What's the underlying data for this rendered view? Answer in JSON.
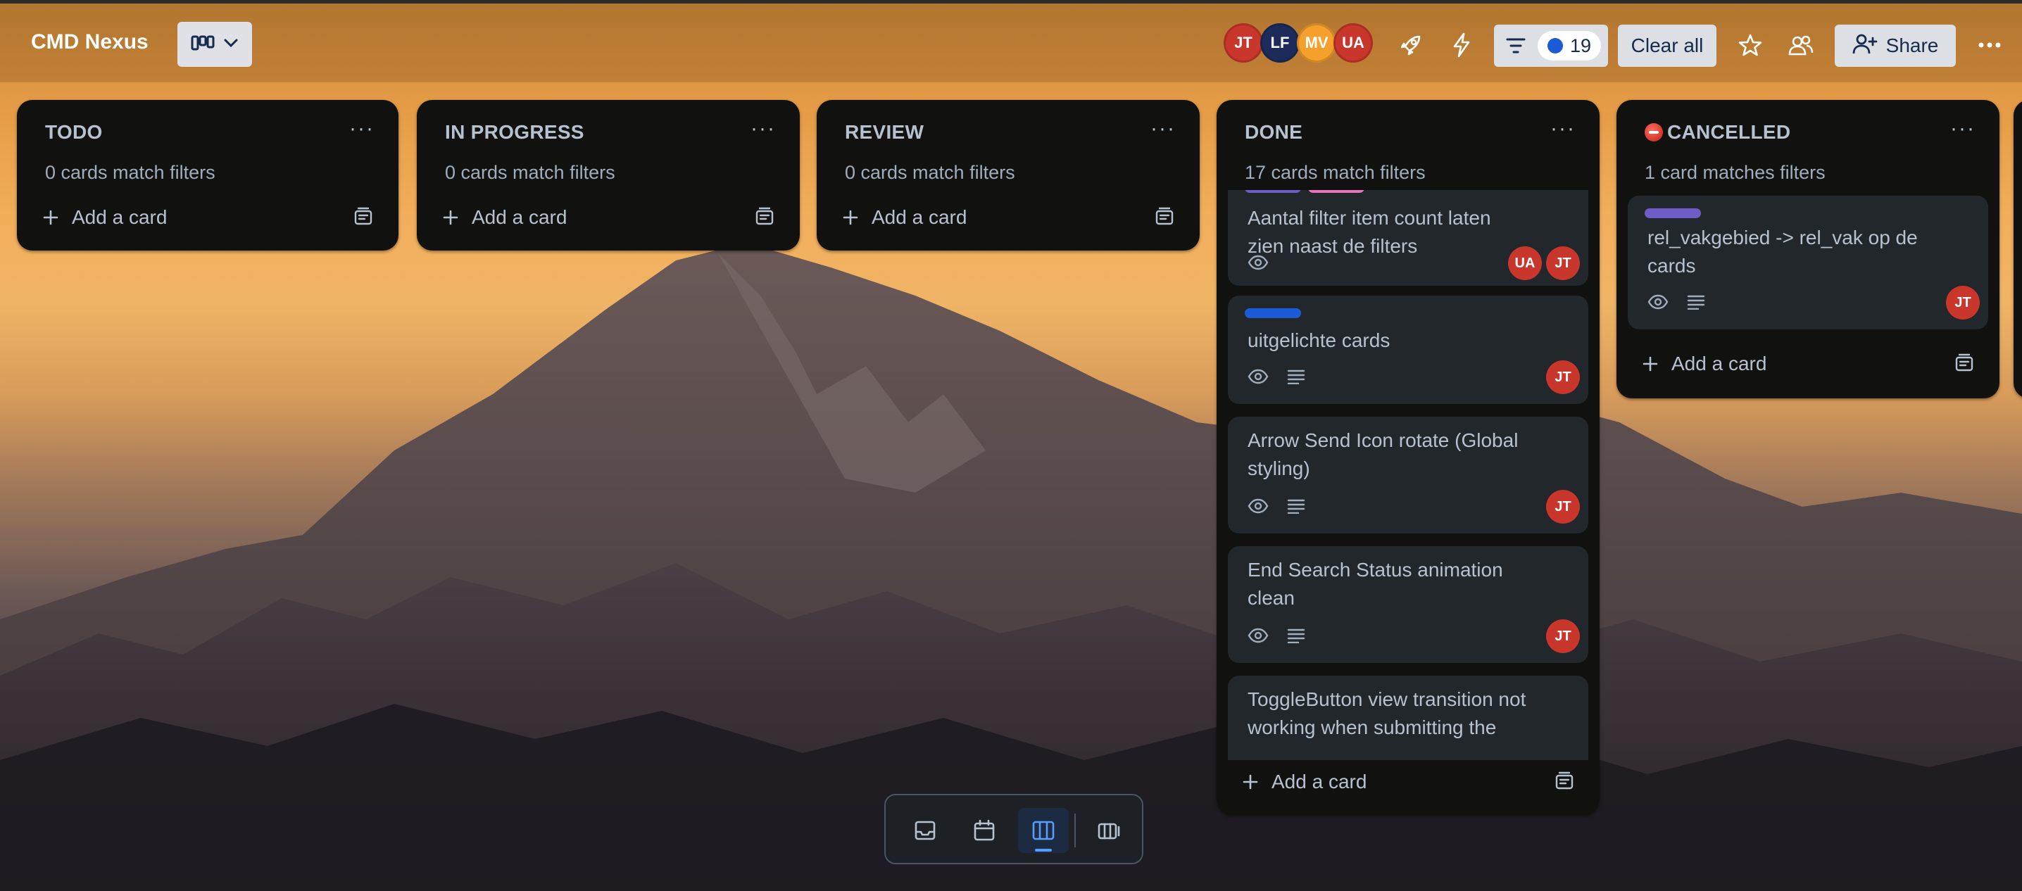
{
  "header": {
    "board_title": "CMD Nexus",
    "members": [
      {
        "initials": "JT",
        "color": "#c9372c"
      },
      {
        "initials": "LF",
        "color": "#1c2b5a"
      },
      {
        "initials": "MV",
        "color": "#f5a02c"
      },
      {
        "initials": "UA",
        "color": "#c9372c"
      }
    ],
    "filter_count": "19",
    "clear_all_label": "Clear all",
    "share_label": "Share"
  },
  "lists": [
    {
      "title": "TODO",
      "subtitle": "0 cards match filters",
      "add_label": "Add a card"
    },
    {
      "title": "IN PROGRESS",
      "subtitle": "0 cards match filters",
      "add_label": "Add a card"
    },
    {
      "title": "REVIEW",
      "subtitle": "0 cards match filters",
      "add_label": "Add a card"
    },
    {
      "title": "DONE",
      "subtitle": "17 cards match filters",
      "add_label": "Add a card",
      "cards": [
        {
          "title_lines": [
            "Aantal filter item count laten",
            "zien naast de filters"
          ],
          "members": [
            "UA",
            "JT"
          ],
          "labels": [
            "#6e5dc6",
            "#e774bb"
          ]
        },
        {
          "title_lines": [
            "uitgelichte cards"
          ],
          "members": [
            "JT"
          ],
          "labels": [
            "#1d5bd6"
          ]
        },
        {
          "title_lines": [
            "Arrow Send Icon rotate (Global",
            "styling)"
          ],
          "members": [
            "JT"
          ]
        },
        {
          "title_lines": [
            "End Search Status animation",
            "clean"
          ],
          "members": [
            "JT"
          ]
        },
        {
          "title_lines": [
            "ToggleButton view transition not",
            "working when submitting the"
          ]
        }
      ]
    },
    {
      "title": "CANCELLED",
      "subtitle": "1 card matches filters",
      "add_label": "Add a card",
      "cards": [
        {
          "title_lines": [
            "rel_vakgebied -> rel_vak op de",
            "cards"
          ],
          "members": [
            "JT"
          ],
          "labels": [
            "#6e5dc6"
          ]
        }
      ]
    }
  ],
  "colors": {
    "list_bg": "#111210",
    "card_bg": "#22272b",
    "text": "#b6c2cf",
    "avatar_red": "#c9372c",
    "accent_blue": "#579dff"
  },
  "icons": [
    "board-view-icon",
    "chevron-down-icon",
    "rocket-icon",
    "lightning-icon",
    "filter-icon",
    "star-icon",
    "visibility-icon",
    "add-person-icon",
    "more-icon",
    "eye-icon",
    "description-icon",
    "plus-icon",
    "template-icon",
    "inbox-icon",
    "calendar-icon",
    "board-icon",
    "switch-boards-icon"
  ]
}
